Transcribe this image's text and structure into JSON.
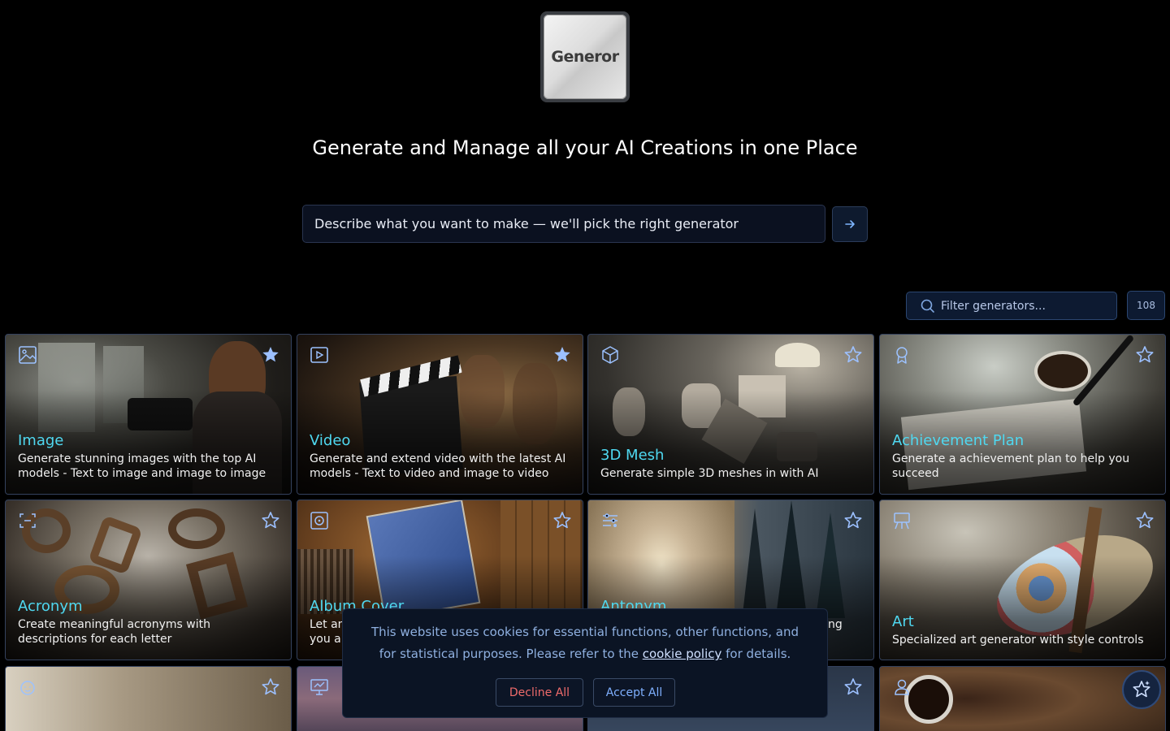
{
  "logo": {
    "text": "Generor"
  },
  "headline": "Generate and Manage all your AI Creations in one Place",
  "prompt": {
    "text": "Describe what you want to make — we'll pick the right generator",
    "submit_icon": "arrow-right-icon"
  },
  "filter": {
    "placeholder": "Filter generators...",
    "icon": "search-icon"
  },
  "generator_count": "108",
  "cards": [
    {
      "title": "Image",
      "desc": "Generate stunning images with the top AI models - Text to image and image to image",
      "icon": "image-icon",
      "starred": true,
      "bg": "photographer"
    },
    {
      "title": "Video",
      "desc": "Generate and extend video with the latest AI models - Text to video and image to video",
      "icon": "play-icon",
      "starred": true,
      "bg": "clapper"
    },
    {
      "title": "3D Mesh",
      "desc": "Generate simple 3D meshes in with AI",
      "icon": "cube-icon",
      "starred": false,
      "bg": "shapes"
    },
    {
      "title": "Achievement Plan",
      "desc": "Generate a achievement plan to help you succeed",
      "icon": "award-icon",
      "starred": false,
      "bg": "desk"
    },
    {
      "title": "Acronym",
      "desc": "Create meaningful acronyms with descriptions for each letter",
      "icon": "scan-icon",
      "starred": false,
      "bg": "letters"
    },
    {
      "title": "Album Cover",
      "desc": "Let an",
      "desc2": "you ar",
      "icon": "disc-icon",
      "starred": false,
      "bg": "record"
    },
    {
      "title": "Antonym",
      "desc": "ng",
      "icon": "sliders-icon",
      "starred": false,
      "bg": "desert"
    },
    {
      "title": "Art",
      "desc": "Specialized art generator with style controls",
      "icon": "easel-icon",
      "starred": false,
      "bg": "palette"
    },
    {
      "title": "",
      "desc": "",
      "icon": "baby-icon",
      "starred": false,
      "bg": "nursery"
    },
    {
      "title": "",
      "desc": "",
      "icon": "presentation-icon",
      "starred": false,
      "bg": "mountains"
    },
    {
      "title": "",
      "desc": "",
      "icon": "",
      "starred": false,
      "bg": "jeans"
    },
    {
      "title": "",
      "desc": "",
      "icon": "user-icon",
      "starred": false,
      "bg": "coffee"
    }
  ],
  "cookie": {
    "text_before": "This website uses cookies for essential functions, other functions, and for statistical purposes. Please refer to the",
    "link": "cookie policy",
    "text_after": "for details.",
    "decline": "Decline All",
    "accept": "Accept All"
  },
  "fab_icon": "ai-sparkle-star-icon",
  "colors": {
    "accent": "#4fd8f0",
    "star": "#8fb4ff",
    "decline": "#ef6b6b",
    "accept": "#7fb0ff"
  }
}
